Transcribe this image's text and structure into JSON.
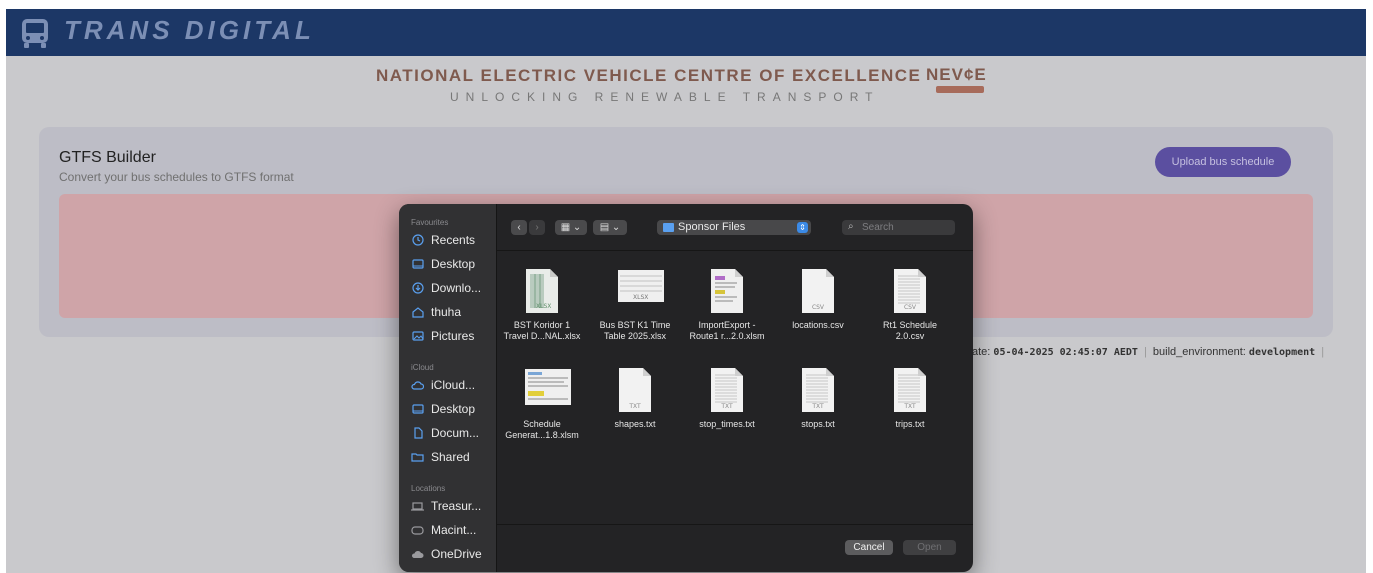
{
  "app": {
    "brand": "TRANS DIGITAL"
  },
  "header": {
    "title": "NATIONAL ELECTRIC VEHICLE CENTRE OF EXCELLENCE",
    "logo_text": "NEV¢E",
    "tagline": "UNLOCKING RENEWABLE TRANSPORT"
  },
  "card": {
    "title": "GTFS Builder",
    "subtitle": "Convert your bus schedules to GTFS format",
    "upload_label": "Upload bus schedule"
  },
  "build_info": {
    "date_label": "ate:",
    "date_value": "05-04-2025 02:45:07 AEDT",
    "env_label": "build_environment:",
    "env_value": "development"
  },
  "dialog": {
    "sidebar": {
      "favourites_label": "Favourites",
      "favourites": [
        "Recents",
        "Desktop",
        "Downlo...",
        "thuha",
        "Pictures"
      ],
      "icloud_label": "iCloud",
      "icloud": [
        "iCloud...",
        "Desktop",
        "Docum...",
        "Shared"
      ],
      "locations_label": "Locations",
      "locations": [
        "Treasur...",
        "Macint...",
        "OneDrive"
      ]
    },
    "toolbar": {
      "path": "Sponsor Files",
      "search_placeholder": "Search"
    },
    "files": [
      {
        "name_line1": "BST Koridor 1",
        "name_line2": "Travel D...NAL.xlsx",
        "badge": "XLSX",
        "kind": "xlsx"
      },
      {
        "name_line1": "Bus BST K1 Time",
        "name_line2": "Table 2025.xlsx",
        "badge": "XLSX",
        "kind": "xlsx-wide"
      },
      {
        "name_line1": "ImportExport -",
        "name_line2": "Route1 r...2.0.xlsm",
        "badge": "",
        "kind": "xlsm"
      },
      {
        "name_line1": "locations.csv",
        "name_line2": "",
        "badge": "CSV",
        "kind": "doc"
      },
      {
        "name_line1": "Rt1 Schedule",
        "name_line2": "2.0.csv",
        "badge": "CSV",
        "kind": "doc-lines"
      },
      {
        "name_line1": "Schedule",
        "name_line2": "Generat...1.8.xlsm",
        "badge": "",
        "kind": "xlsm-wide"
      },
      {
        "name_line1": "shapes.txt",
        "name_line2": "",
        "badge": "TXT",
        "kind": "doc"
      },
      {
        "name_line1": "stop_times.txt",
        "name_line2": "",
        "badge": "TXT",
        "kind": "doc-lines"
      },
      {
        "name_line1": "stops.txt",
        "name_line2": "",
        "badge": "TXT",
        "kind": "doc-lines"
      },
      {
        "name_line1": "trips.txt",
        "name_line2": "",
        "badge": "TXT",
        "kind": "doc-lines"
      }
    ],
    "cancel_label": "Cancel",
    "open_label": "Open"
  }
}
